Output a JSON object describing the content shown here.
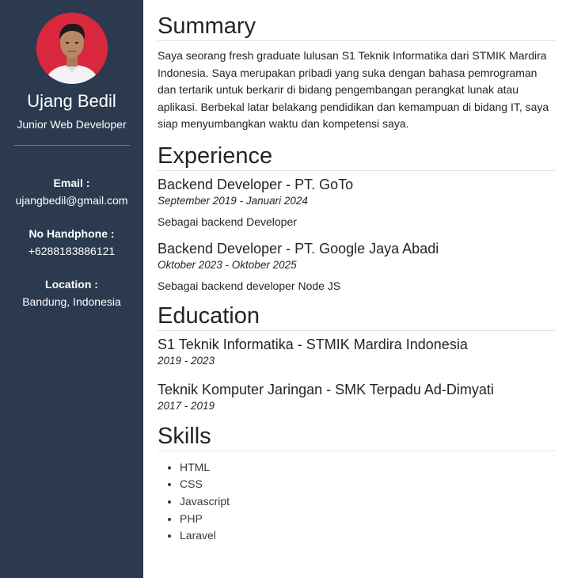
{
  "profile": {
    "name": "Ujang Bedil",
    "job_title": "Junior Web Developer"
  },
  "contact": [
    {
      "label": "Email :",
      "value": "ujangbedil@gmail.com"
    },
    {
      "label": "No Handphone :",
      "value": "+6288183886121"
    },
    {
      "label": "Location :",
      "value": "Bandung, Indonesia"
    }
  ],
  "summary": {
    "title": "Summary",
    "text": "Saya seorang fresh graduate lulusan S1 Teknik Informatika dari STMIK Mardira Indonesia. Saya merupakan pribadi yang suka dengan bahasa pemrograman dan tertarik untuk berkarir di bidang pengembangan perangkat lunak atau aplikasi. Berbekal latar belakang pendidikan dan kemampuan di bidang IT, saya siap menyumbangkan waktu dan kompetensi saya."
  },
  "experience": {
    "title": "Experience",
    "items": [
      {
        "role": "Backend Developer - PT. GoTo",
        "period": "September 2019 - Januari 2024",
        "desc": "Sebagai backend Developer"
      },
      {
        "role": "Backend Developer - PT. Google Jaya Abadi",
        "period": "Oktober 2023 - Oktober 2025",
        "desc": "Sebagai backend developer Node JS"
      }
    ]
  },
  "education": {
    "title": "Education",
    "items": [
      {
        "degree": "S1 Teknik Informatika - STMIK Mardira Indonesia",
        "period": "2019 - 2023"
      },
      {
        "degree": "Teknik Komputer Jaringan - SMK Terpadu Ad-Dimyati",
        "period": "2017 - 2019"
      }
    ]
  },
  "skills": {
    "title": "Skills",
    "items": [
      "HTML",
      "CSS",
      "Javascript",
      "PHP",
      "Laravel"
    ]
  },
  "colors": {
    "sidebar_bg": "#2b3a4f",
    "avatar_bg": "#d9283e",
    "text": "#212529"
  }
}
